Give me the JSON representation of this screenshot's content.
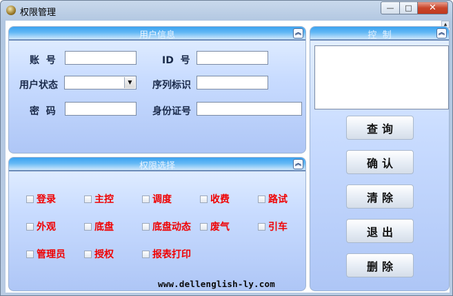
{
  "window": {
    "title": "权限管理"
  },
  "titlebar": {
    "min_glyph": "—",
    "max_glyph": "□",
    "close_glyph": "✕"
  },
  "user_info": {
    "title": "用户信息",
    "account_label": "账  号",
    "id_label": "ID  号",
    "status_label": "用户状态",
    "serial_label": "序列标识",
    "password_label": "密  码",
    "idcard_label": "身份证号",
    "account_value": "",
    "id_value": "",
    "status_value": "",
    "serial_value": "",
    "password_value": "",
    "idcard_value": ""
  },
  "permissions": {
    "title": "权限选择",
    "items": [
      "登录",
      "主控",
      "调度",
      "收费",
      "路试",
      "外观",
      "底盘",
      "底盘动态",
      "废气",
      "引车",
      "管理员",
      "授权",
      "报表打印"
    ],
    "checked": [
      false,
      false,
      false,
      false,
      false,
      false,
      false,
      false,
      false,
      false,
      false,
      false,
      false
    ],
    "footer_url": "www.dellenglish-ly.com"
  },
  "control": {
    "title": "控  制",
    "textarea_value": "",
    "buttons": [
      "查询",
      "确认",
      "清除",
      "退出",
      "删除"
    ]
  },
  "colors": {
    "permission_label": "#f00000",
    "header_gradient": "#3aa3f0"
  },
  "icons": {
    "collapse": "⌃⌃"
  }
}
